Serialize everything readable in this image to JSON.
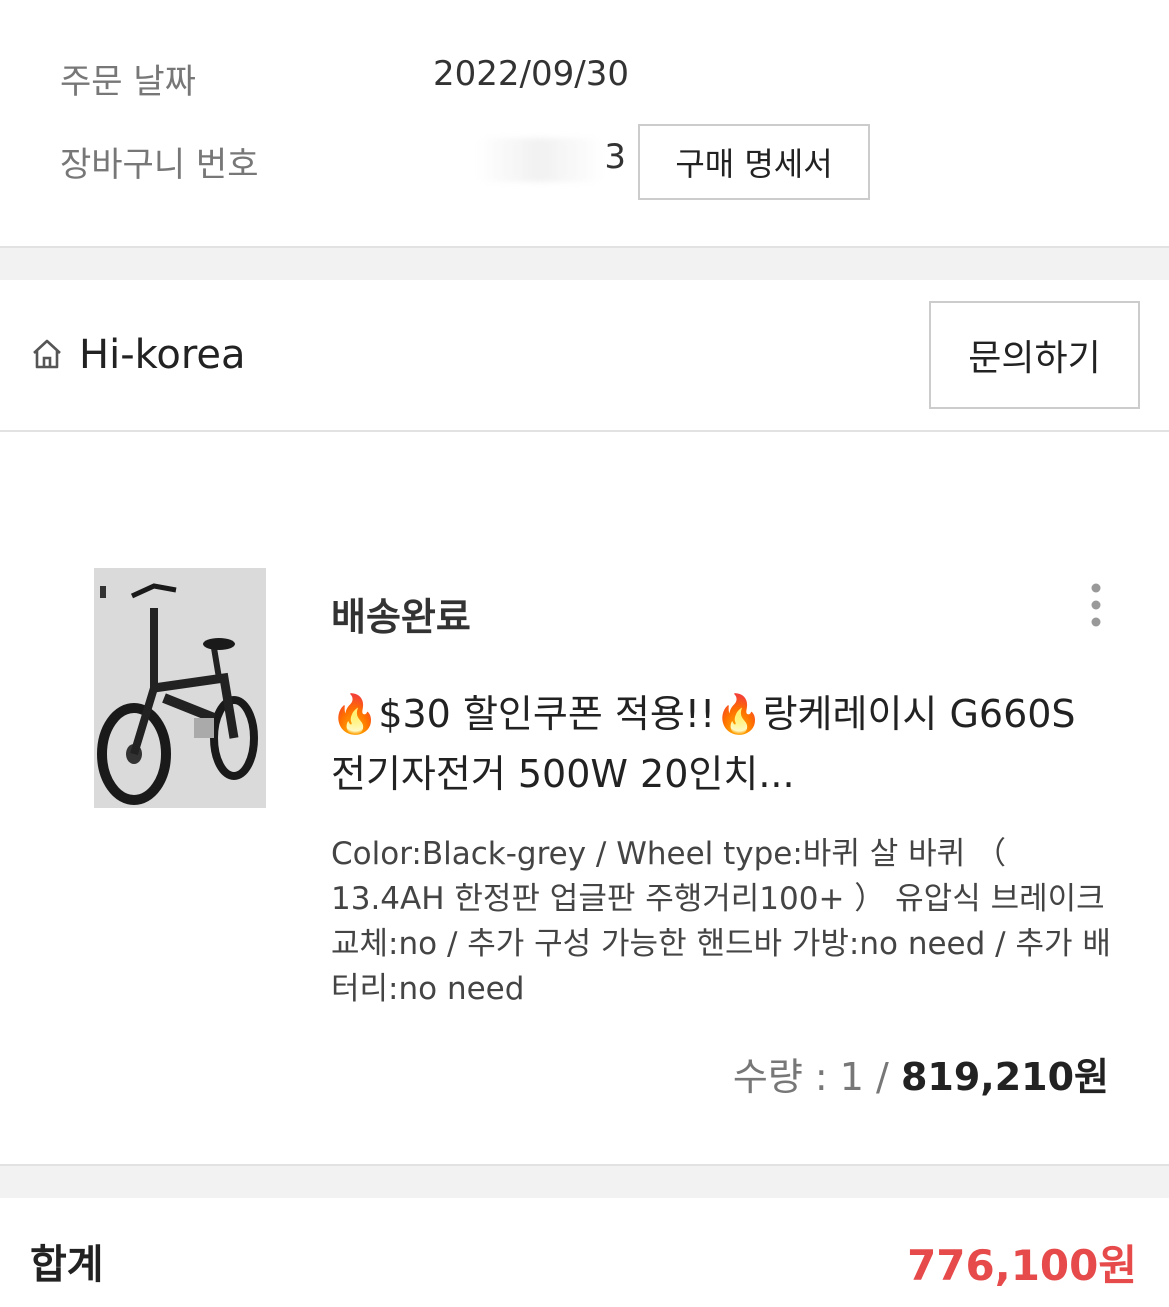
{
  "order": {
    "date_label": "주문 날짜",
    "date_value": "2022/09/30",
    "cart_label": "장바구니 번호",
    "cart_value": "3",
    "receipt_button": "구매 명세서"
  },
  "store": {
    "icon": "home-icon",
    "name": "Hi-korea",
    "inquiry_button": "문의하기"
  },
  "item": {
    "status": "배송완료",
    "title_part1": "$30 할인쿠폰 적용!!",
    "title_part2": "랑케레이시 G660S 전기자전거 500W 20인치...",
    "options": "Color:Black-grey / Wheel type:바퀴 살 바퀴 （ 13.4AH 한정판 업글판 주행거리100+ ） 유압식 브레이크 교체:no / 추가 구성 가능한 핸드바 가방:no need / 추가 배터리:no need",
    "quantity_label": "수량 : 1 / ",
    "price": "819,210원",
    "more_icon": "more-vertical-icon"
  },
  "total": {
    "label": "합계",
    "value": "776,100원"
  },
  "colors": {
    "accent_red": "#e64a4a",
    "divider": "#f2f2f2"
  }
}
